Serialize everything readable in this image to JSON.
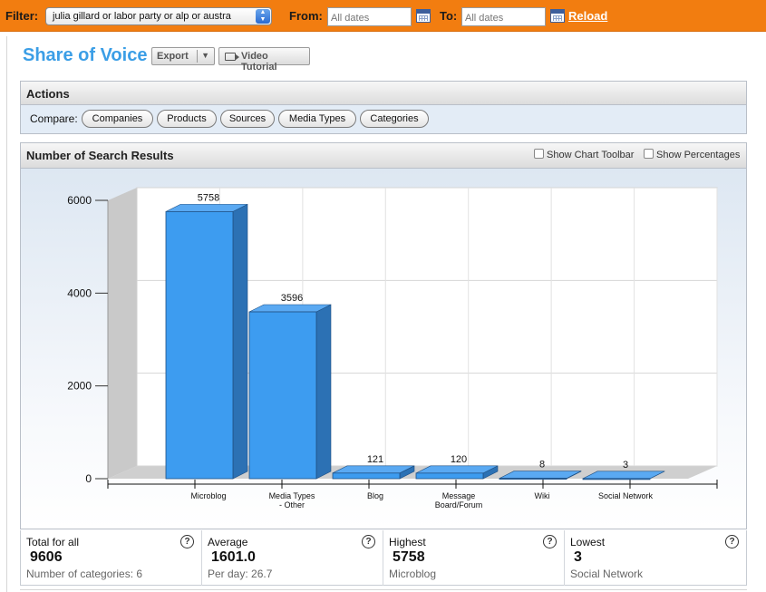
{
  "filter": {
    "filter_label": "Filter:",
    "query_value": "julia gillard or labor party or alp or austra",
    "from_label": "From:",
    "from_placeholder": "All dates",
    "to_label": "To:",
    "to_placeholder": "All dates",
    "reload_label": "Reload"
  },
  "header": {
    "title": "Share of Voice",
    "export_label": "Export",
    "video_label": "Video Tutorial"
  },
  "actions": {
    "title": "Actions",
    "compare_label": "Compare:",
    "buttons": [
      "Companies",
      "Products",
      "Sources",
      "Media Types",
      "Categories"
    ]
  },
  "chart_panel": {
    "title": "Number of Search Results",
    "show_toolbar_label": "Show Chart Toolbar",
    "show_percentages_label": "Show Percentages"
  },
  "chart_data": {
    "type": "bar",
    "categories": [
      "Microblog",
      "Media Types - Other",
      "Blog",
      "Message Board/Forum",
      "Wiki",
      "Social Network"
    ],
    "values": [
      5758,
      3596,
      121,
      120,
      8,
      3
    ],
    "yticks": [
      "6000",
      "4000",
      "2000",
      "0"
    ],
    "ylim": [
      0,
      6000
    ],
    "grid": true,
    "three_d": true,
    "bar_color": "#3d9cf0"
  },
  "stats": [
    {
      "label": "Total for all",
      "value": "9606",
      "sub": "Number of categories: 6"
    },
    {
      "label": "Average",
      "value": "1601.0",
      "sub": "Per day: 26.7"
    },
    {
      "label": "Highest",
      "value": "5758",
      "sub": "Microblog"
    },
    {
      "label": "Lowest",
      "value": "3",
      "sub": "Social Network"
    }
  ],
  "help_glyph": "?",
  "colors": {
    "filter_bar": "#f27d10",
    "title_blue": "#3b9ee6",
    "bar_blue": "#3d9cf0",
    "actions_bg": "#e3ecf6"
  }
}
